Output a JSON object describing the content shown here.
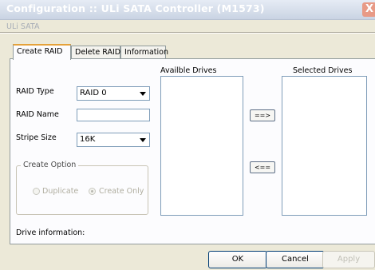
{
  "window": {
    "title": "Configuration :: ULi SATA Controller (M1573)",
    "subtitle": "ULi SATA",
    "close_glyph": "X"
  },
  "tabs": [
    {
      "label": "Create RAID",
      "active": true
    },
    {
      "label": "Delete RAID",
      "active": false
    },
    {
      "label": "Information",
      "active": false
    }
  ],
  "form": {
    "raid_type_label": "RAID Type",
    "raid_type_value": "RAID 0",
    "raid_name_label": "RAID Name",
    "raid_name_value": "",
    "stripe_size_label": "Stripe Size",
    "stripe_size_value": "16K"
  },
  "create_option": {
    "title": "Create Option",
    "duplicate_label": "Duplicate",
    "create_only_label": "Create Only",
    "selected": "Create Only"
  },
  "drives": {
    "available_header": "Availble Drives",
    "selected_header": "Selected Drives",
    "add_label": "==>",
    "remove_label": "<==",
    "available": [],
    "selected": []
  },
  "drive_information_label": "Drive information:",
  "buttons": {
    "ok": "OK",
    "cancel": "Cancel",
    "apply": "Apply"
  },
  "colors": {
    "title_text": "#ffffff",
    "close_button": "#e89a86",
    "tab_highlight": "#e5a23a",
    "field_border": "#7f9db9"
  }
}
